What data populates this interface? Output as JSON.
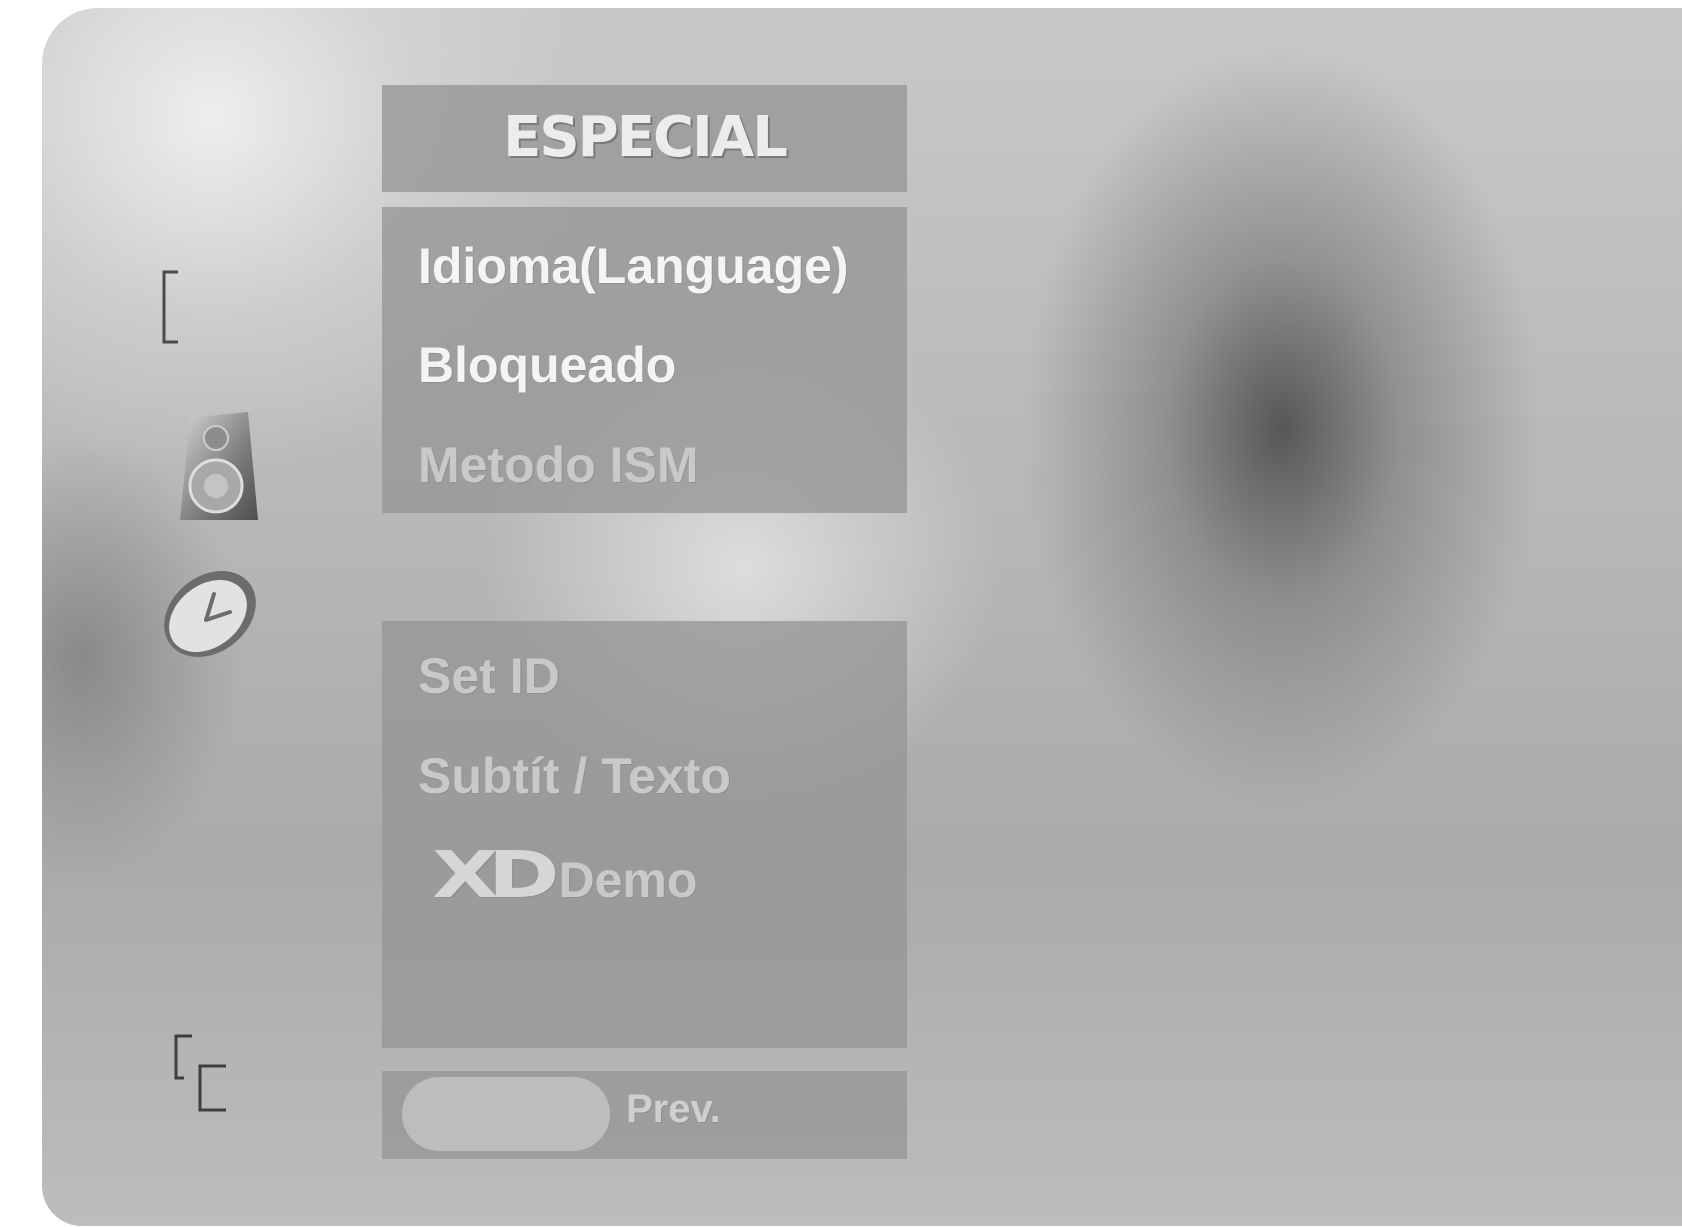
{
  "menu": {
    "title": "ESPECIAL",
    "items_top": [
      {
        "label": "Idioma(Language)"
      },
      {
        "label": "Bloqueado"
      },
      {
        "label": "Metodo ISM"
      }
    ],
    "items_bottom": [
      {
        "label": "Set ID"
      },
      {
        "label": "Subtít / Texto"
      },
      {
        "logo": "XD",
        "label": "Demo"
      }
    ]
  },
  "footer": {
    "prev_label": "Prev."
  },
  "side_icons": [
    "bracket-icon",
    "speaker-icon",
    "clock-icon",
    "input-icon"
  ]
}
